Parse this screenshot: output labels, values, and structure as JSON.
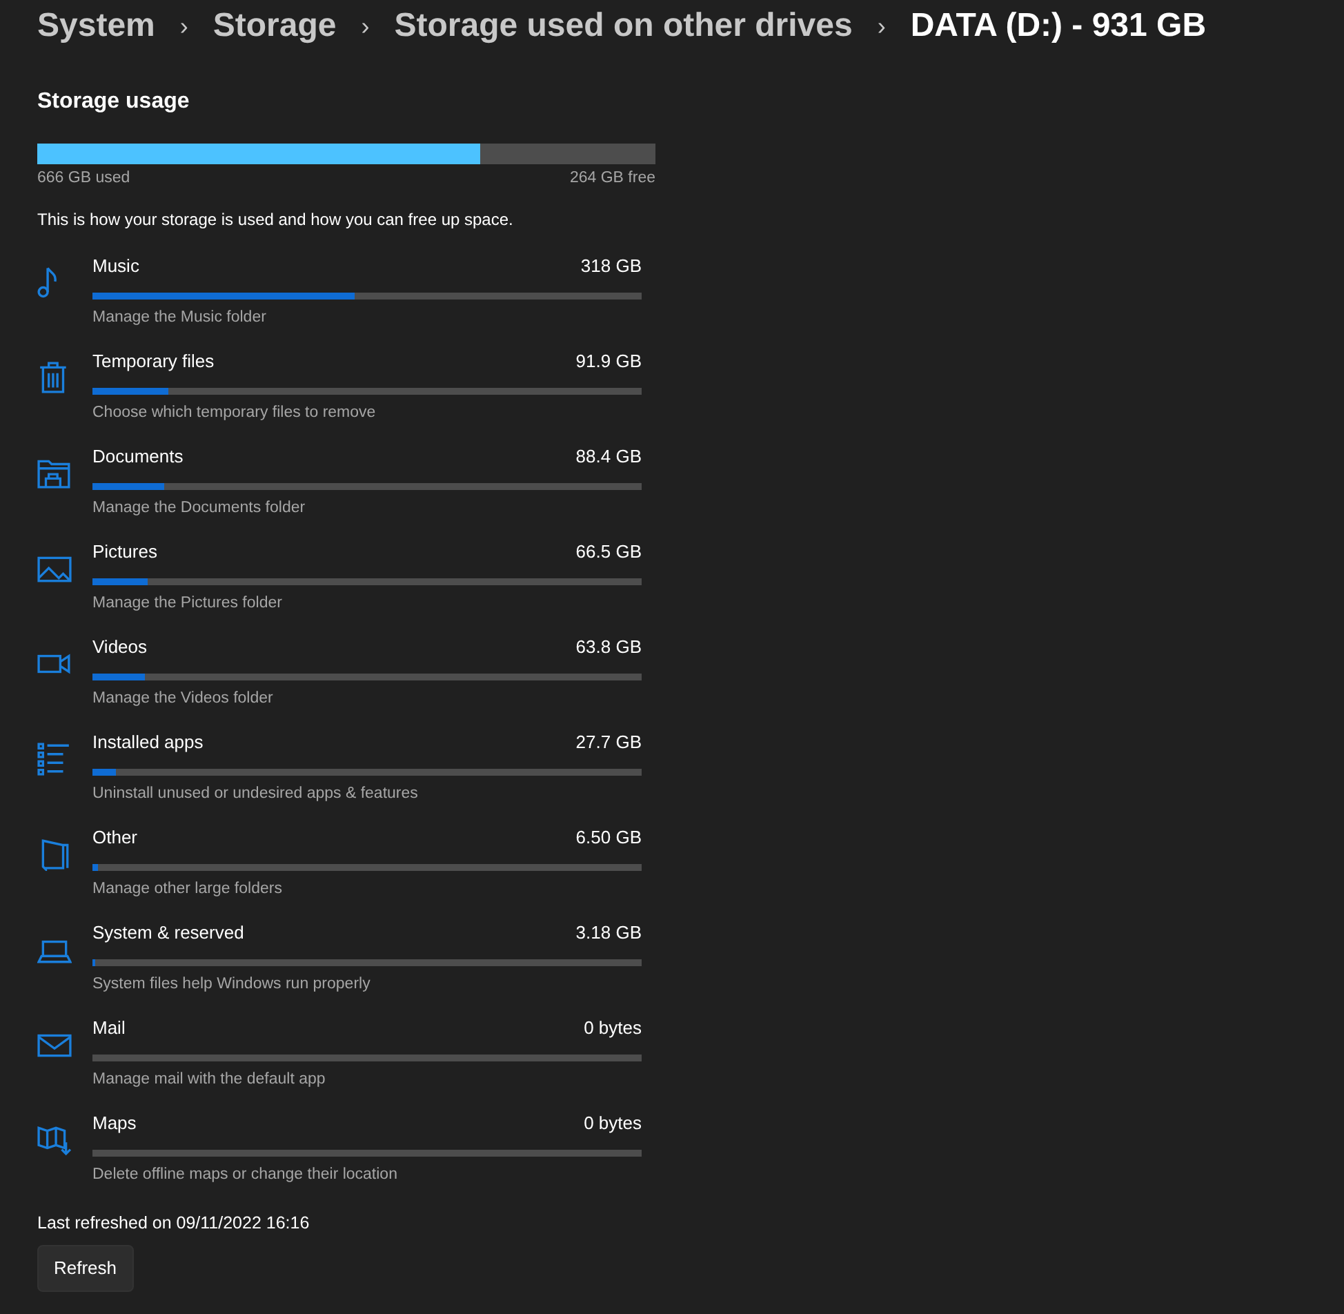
{
  "breadcrumb": [
    {
      "label": "System",
      "current": false
    },
    {
      "label": "Storage",
      "current": false
    },
    {
      "label": "Storage used on other drives",
      "current": false
    },
    {
      "label": "DATA (D:) - 931 GB",
      "current": true
    }
  ],
  "breadcrumb_separator": "›",
  "section_title": "Storage usage",
  "usage": {
    "level": 0.716,
    "used": "666 GB used",
    "free": "264 GB free"
  },
  "description": "This is how your storage is used and how you can free up space.",
  "categories": [
    {
      "kind": "music",
      "name": "Music",
      "size": "318 GB",
      "level": 0.477,
      "subtitle": "Manage the Music folder"
    },
    {
      "kind": "trash",
      "name": "Temporary files",
      "size": "91.9 GB",
      "level": 0.138,
      "subtitle": "Choose which temporary files to remove"
    },
    {
      "kind": "documents",
      "name": "Documents",
      "size": "88.4 GB",
      "level": 0.131,
      "subtitle": "Manage the Documents folder"
    },
    {
      "kind": "pictures",
      "name": "Pictures",
      "size": "66.5 GB",
      "level": 0.1,
      "subtitle": "Manage the Pictures folder"
    },
    {
      "kind": "videos",
      "name": "Videos",
      "size": "63.8 GB",
      "level": 0.095,
      "subtitle": "Manage the Videos folder"
    },
    {
      "kind": "apps",
      "name": "Installed apps",
      "size": "27.7 GB",
      "level": 0.043,
      "subtitle": "Uninstall unused or undesired apps & features"
    },
    {
      "kind": "other",
      "name": "Other",
      "size": "6.50 GB",
      "level": 0.01,
      "subtitle": "Manage other large folders"
    },
    {
      "kind": "system",
      "name": "System & reserved",
      "size": "3.18 GB",
      "level": 0.004,
      "subtitle": "System files help Windows run properly"
    },
    {
      "kind": "mail",
      "name": "Mail",
      "size": "0 bytes",
      "level": 0,
      "subtitle": "Manage mail with the default app"
    },
    {
      "kind": "maps",
      "name": "Maps",
      "size": "0 bytes",
      "level": 0,
      "subtitle": "Delete offline maps or change their location"
    }
  ],
  "last_refreshed": "Last refreshed on 09/11/2022 16:16",
  "refresh_button": "Refresh"
}
